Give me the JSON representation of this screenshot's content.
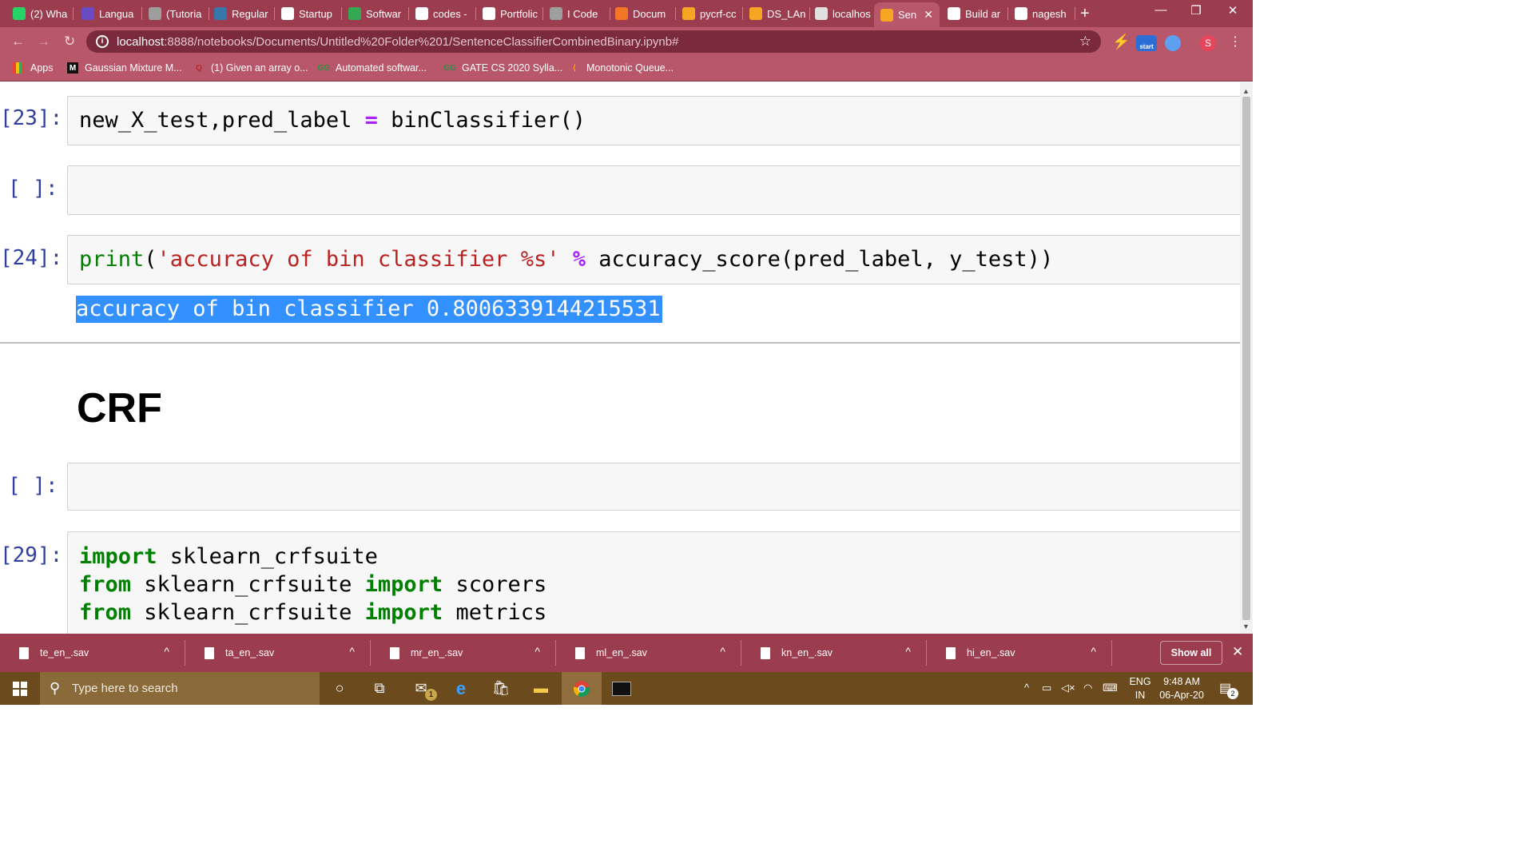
{
  "tabs": [
    {
      "label": "(2) Wha",
      "icon": "whatsapp-icon",
      "color": "#25d366"
    },
    {
      "label": "Langua",
      "icon": "image-icon",
      "color": "#6a4bc4"
    },
    {
      "label": "(Tutoria",
      "icon": "globe-icon",
      "color": "#9e9e9e"
    },
    {
      "label": "Regular",
      "icon": "python-icon",
      "color": "#3776ab"
    },
    {
      "label": "Startup",
      "icon": "startup-icon",
      "color": "#ffffff"
    },
    {
      "label": "Softwar",
      "icon": "doc-icon",
      "color": "#34a853"
    },
    {
      "label": "codes -",
      "icon": "gmail-icon",
      "color": "#ffffff"
    },
    {
      "label": "Portfolic",
      "icon": "portfolio-icon",
      "color": "#ffffff"
    },
    {
      "label": "I Code",
      "icon": "globe-icon",
      "color": "#9e9e9e"
    },
    {
      "label": "Docum",
      "icon": "jupyter-icon",
      "color": "#f37626"
    },
    {
      "label": "pycrf-cc",
      "icon": "notebook-icon",
      "color": "#f5a623"
    },
    {
      "label": "DS_LAn",
      "icon": "notebook-icon",
      "color": "#f5a623"
    },
    {
      "label": "localhos",
      "icon": "notebook-icon",
      "color": "#e0e0e0"
    },
    {
      "label": "Sen",
      "icon": "notebook-icon",
      "color": "#f5a623",
      "active": true
    },
    {
      "label": "Build ar",
      "icon": "github-icon",
      "color": "#ffffff"
    },
    {
      "label": "nagesh",
      "icon": "github-icon",
      "color": "#ffffff"
    }
  ],
  "window": {
    "minimize": "—",
    "restore": "❐",
    "close": "✕",
    "new_tab": "+"
  },
  "address": {
    "host": "localhost",
    "path": ":8888/notebooks/Documents/Untitled%20Folder%201/SentenceClassifierCombinedBinary.ipynb#",
    "profile_initial": "S",
    "ext_start_label": "start"
  },
  "bookmarks": [
    {
      "label": "Apps",
      "icon": "apps-grid-icon"
    },
    {
      "label": "Gaussian Mixture M...",
      "icon": "medium-icon",
      "glyph": "M"
    },
    {
      "label": "(1) Given an array o...",
      "icon": "quora-icon",
      "glyph": "Q"
    },
    {
      "label": "Automated softwar...",
      "icon": "gfg-icon",
      "glyph": "GG"
    },
    {
      "label": "GATE CS 2020 Sylla...",
      "icon": "gfg-icon",
      "glyph": "GG"
    },
    {
      "label": "Monotonic Queue...",
      "icon": "leetcode-icon",
      "glyph": "⟨"
    }
  ],
  "notebook": {
    "cells": [
      {
        "prompt": "[23]:",
        "lines": [
          "new_X_test,pred_label = binClassifier()"
        ]
      },
      {
        "prompt": "[ ]:"
      },
      {
        "prompt": "[24]:",
        "line": "print('accuracy of bin classifier %s' % accuracy_score(pred_label, y_test))",
        "output": "accuracy of bin classifier 0.8006339144215531"
      },
      {
        "prompt": "[ ]:"
      },
      {
        "prompt": "[29]:",
        "lines": [
          "import sklearn_crfsuite",
          "from sklearn_crfsuite import scorers",
          "from sklearn_crfsuite import metrics"
        ]
      }
    ],
    "heading": "CRF"
  },
  "downloads": [
    {
      "name": "te_en_.sav"
    },
    {
      "name": "ta_en_.sav"
    },
    {
      "name": "mr_en_.sav"
    },
    {
      "name": "ml_en_.sav"
    },
    {
      "name": "kn_en_.sav"
    },
    {
      "name": "hi_en_.sav"
    }
  ],
  "download_bar": {
    "show_all": "Show all"
  },
  "taskbar": {
    "search_placeholder": "Type here to search",
    "mail_badge": "1",
    "lang_top": "ENG",
    "lang_bottom": "IN",
    "time": "9:48 AM",
    "date": "06-Apr-20",
    "notif_count": "2"
  },
  "colors": {
    "accent": "#b8566a",
    "tab_bar": "#9b3d4f",
    "selection": "#3390ff",
    "prompt": "#303f9f"
  }
}
